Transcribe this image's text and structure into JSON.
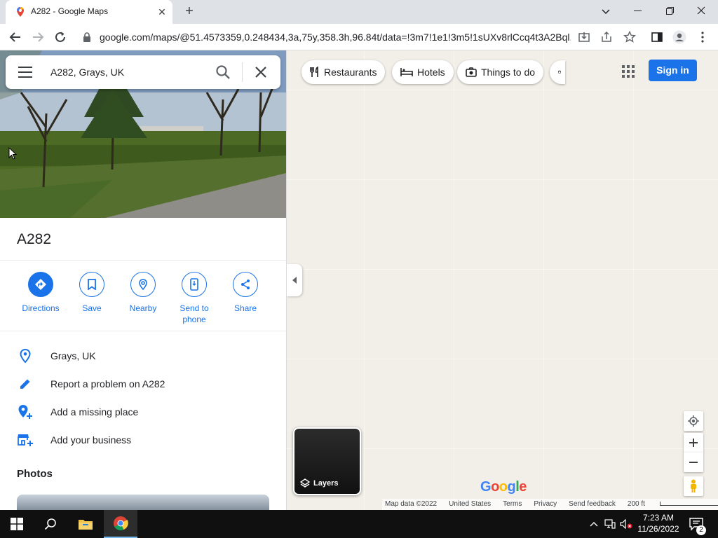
{
  "browser": {
    "tab_title": "A282 - Google Maps",
    "url": "google.com/maps/@51.4573359,0.248434,3a,75y,358.3h,96.84t/data=!3m7!1e1!3m5!1sUXv8rlCcq4t3A2Bql..."
  },
  "search": {
    "value": "A282, Grays, UK"
  },
  "place": {
    "title": "A282",
    "actions": {
      "directions": "Directions",
      "save": "Save",
      "nearby": "Nearby",
      "send_to_phone": "Send to phone",
      "share": "Share"
    },
    "info_rows": {
      "location": "Grays, UK",
      "report": "Report a problem on A282",
      "missing_place": "Add a missing place",
      "business": "Add your business"
    },
    "photos_heading": "Photos"
  },
  "map": {
    "chips": {
      "restaurants": "Restaurants",
      "hotels": "Hotels",
      "things_to_do": "Things to do"
    },
    "sign_in": "Sign in",
    "layers": "Layers",
    "logo": {
      "g1": "G",
      "o1": "o",
      "o2": "o",
      "g2": "g",
      "l": "l",
      "e": "e"
    },
    "logo_colors": [
      "#4285f4",
      "#ea4335",
      "#fbbc05",
      "#4285f4",
      "#34a853",
      "#ea4335"
    ],
    "attribution": {
      "map_data": "Map data ©2022",
      "country": "United States",
      "terms": "Terms",
      "privacy": "Privacy",
      "feedback": "Send feedback",
      "scale": "200 ft"
    }
  },
  "taskbar": {
    "time": "7:23 AM",
    "date": "11/26/2022",
    "notifications": "2"
  },
  "colors": {
    "accent": "#1a73e8",
    "map_bg": "#f2efe9"
  }
}
